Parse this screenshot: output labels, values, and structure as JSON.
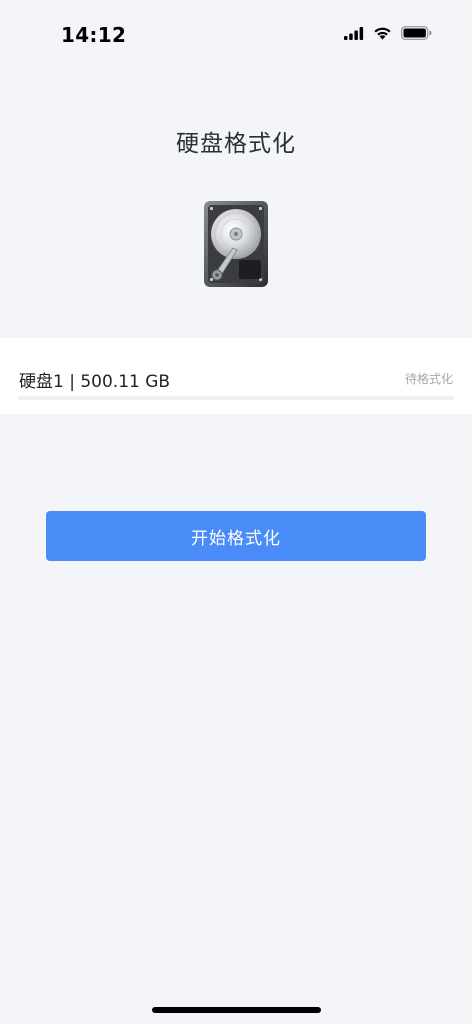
{
  "status_bar": {
    "time": "14:12",
    "icons": [
      "cellular-signal-icon",
      "wifi-icon",
      "battery-icon"
    ]
  },
  "page": {
    "title": "硬盘格式化",
    "image": "hard-disk-drive"
  },
  "disk": {
    "name": "硬盘1 | 500.11 GB",
    "status": "待格式化",
    "progress": 0
  },
  "actions": {
    "start_label": "开始格式化"
  },
  "colors": {
    "background": "#f3f5f9",
    "panel": "#ffffff",
    "accent": "#4a8cf7",
    "progress_track": "#eef0f3",
    "muted_text": "#a3a8b0"
  }
}
